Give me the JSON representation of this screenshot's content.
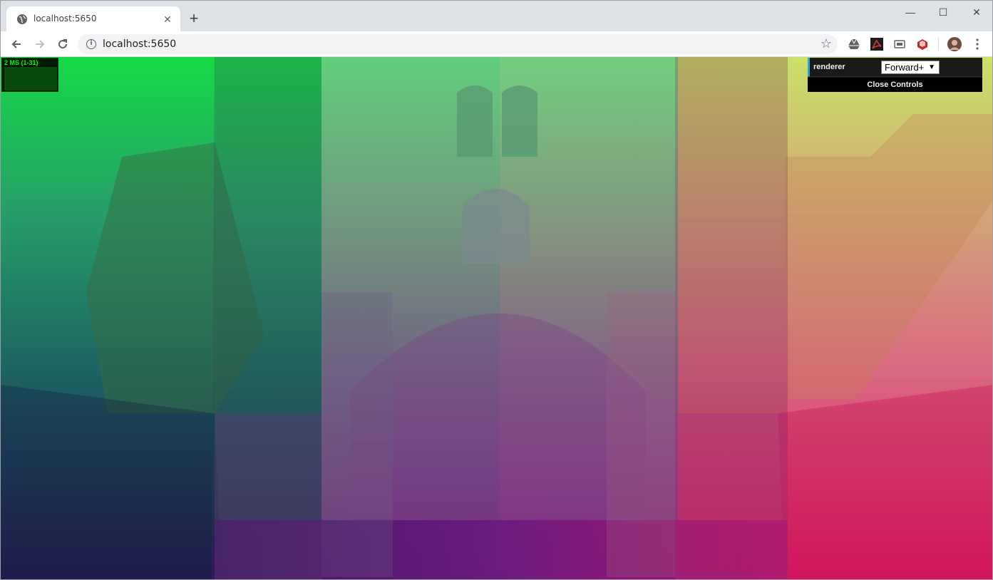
{
  "tab": {
    "title": "localhost:5650"
  },
  "address_bar": {
    "url": "localhost:5650"
  },
  "stats": {
    "label": "2 MS (1-31)"
  },
  "gui": {
    "renderer_label": "renderer",
    "renderer_value": "Forward+",
    "close_label": "Close Controls"
  },
  "icons": [
    "globe-icon",
    "close-icon",
    "plus-icon",
    "minimize-icon",
    "maximize-icon",
    "window-close-icon",
    "back-arrow-icon",
    "forward-arrow-icon",
    "reload-icon",
    "info-icon",
    "star-icon",
    "drive-icon",
    "acrobat-icon",
    "cast-icon",
    "extension-icon",
    "avatar",
    "more-vert-icon"
  ]
}
